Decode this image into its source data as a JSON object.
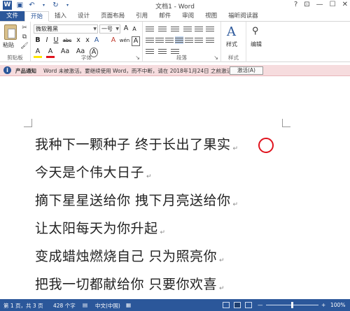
{
  "titlebar": {
    "title": "文档1 - Word",
    "controls": [
      "?",
      "⊡",
      "—",
      "☐",
      "✕"
    ]
  },
  "tabs": [
    "文件",
    "开始",
    "插入",
    "设计",
    "页面布局",
    "引用",
    "邮件",
    "审阅",
    "视图",
    "福昕阅读器"
  ],
  "ribbon": {
    "clipboard": {
      "paste": "粘贴",
      "label": "剪贴板"
    },
    "font": {
      "font_name": "微软雅黑",
      "font_size": "一号",
      "grow": "A",
      "shrink": "A",
      "aa": "Aa",
      "clear": "A",
      "wen": "wén",
      "border_a": "A",
      "bold": "B",
      "italic": "I",
      "underline": "U",
      "strike": "abc",
      "sub": "x",
      "sup": "x",
      "highlight": "A",
      "color": "A",
      "case": "Aa",
      "big_a": "A",
      "char": "A",
      "label": "字体"
    },
    "paragraph": {
      "label": "段落"
    },
    "styles": {
      "button": "样式",
      "label": "样式"
    },
    "editing": {
      "button": "编辑"
    }
  },
  "notification": {
    "title": "产品通知",
    "message": "Word 未被激活。要继续使用 Word，而不中断，请在 2018年1月24日 之前激活。",
    "button": "激活(A)"
  },
  "document": {
    "lines": [
      "我种下一颗种子  终于长出了果实",
      "今天是个伟大日子",
      "摘下星星送给你  拽下月亮送给你",
      "让太阳每天为你升起",
      "变成蜡烛燃烧自己  只为照亮你",
      "把我一切都献给你  只要你欢喜"
    ],
    "paragraph_mark": "↵"
  },
  "status": {
    "page": "第 1 页，共 3 页",
    "words": "428 个字",
    "language": "中文(中国)",
    "zoom": "100%",
    "zoom_minus": "—",
    "zoom_plus": "+"
  },
  "colors": {
    "brand": "#2b579a",
    "notification_bg": "#f6dcde",
    "annotation": "#e0141e"
  }
}
